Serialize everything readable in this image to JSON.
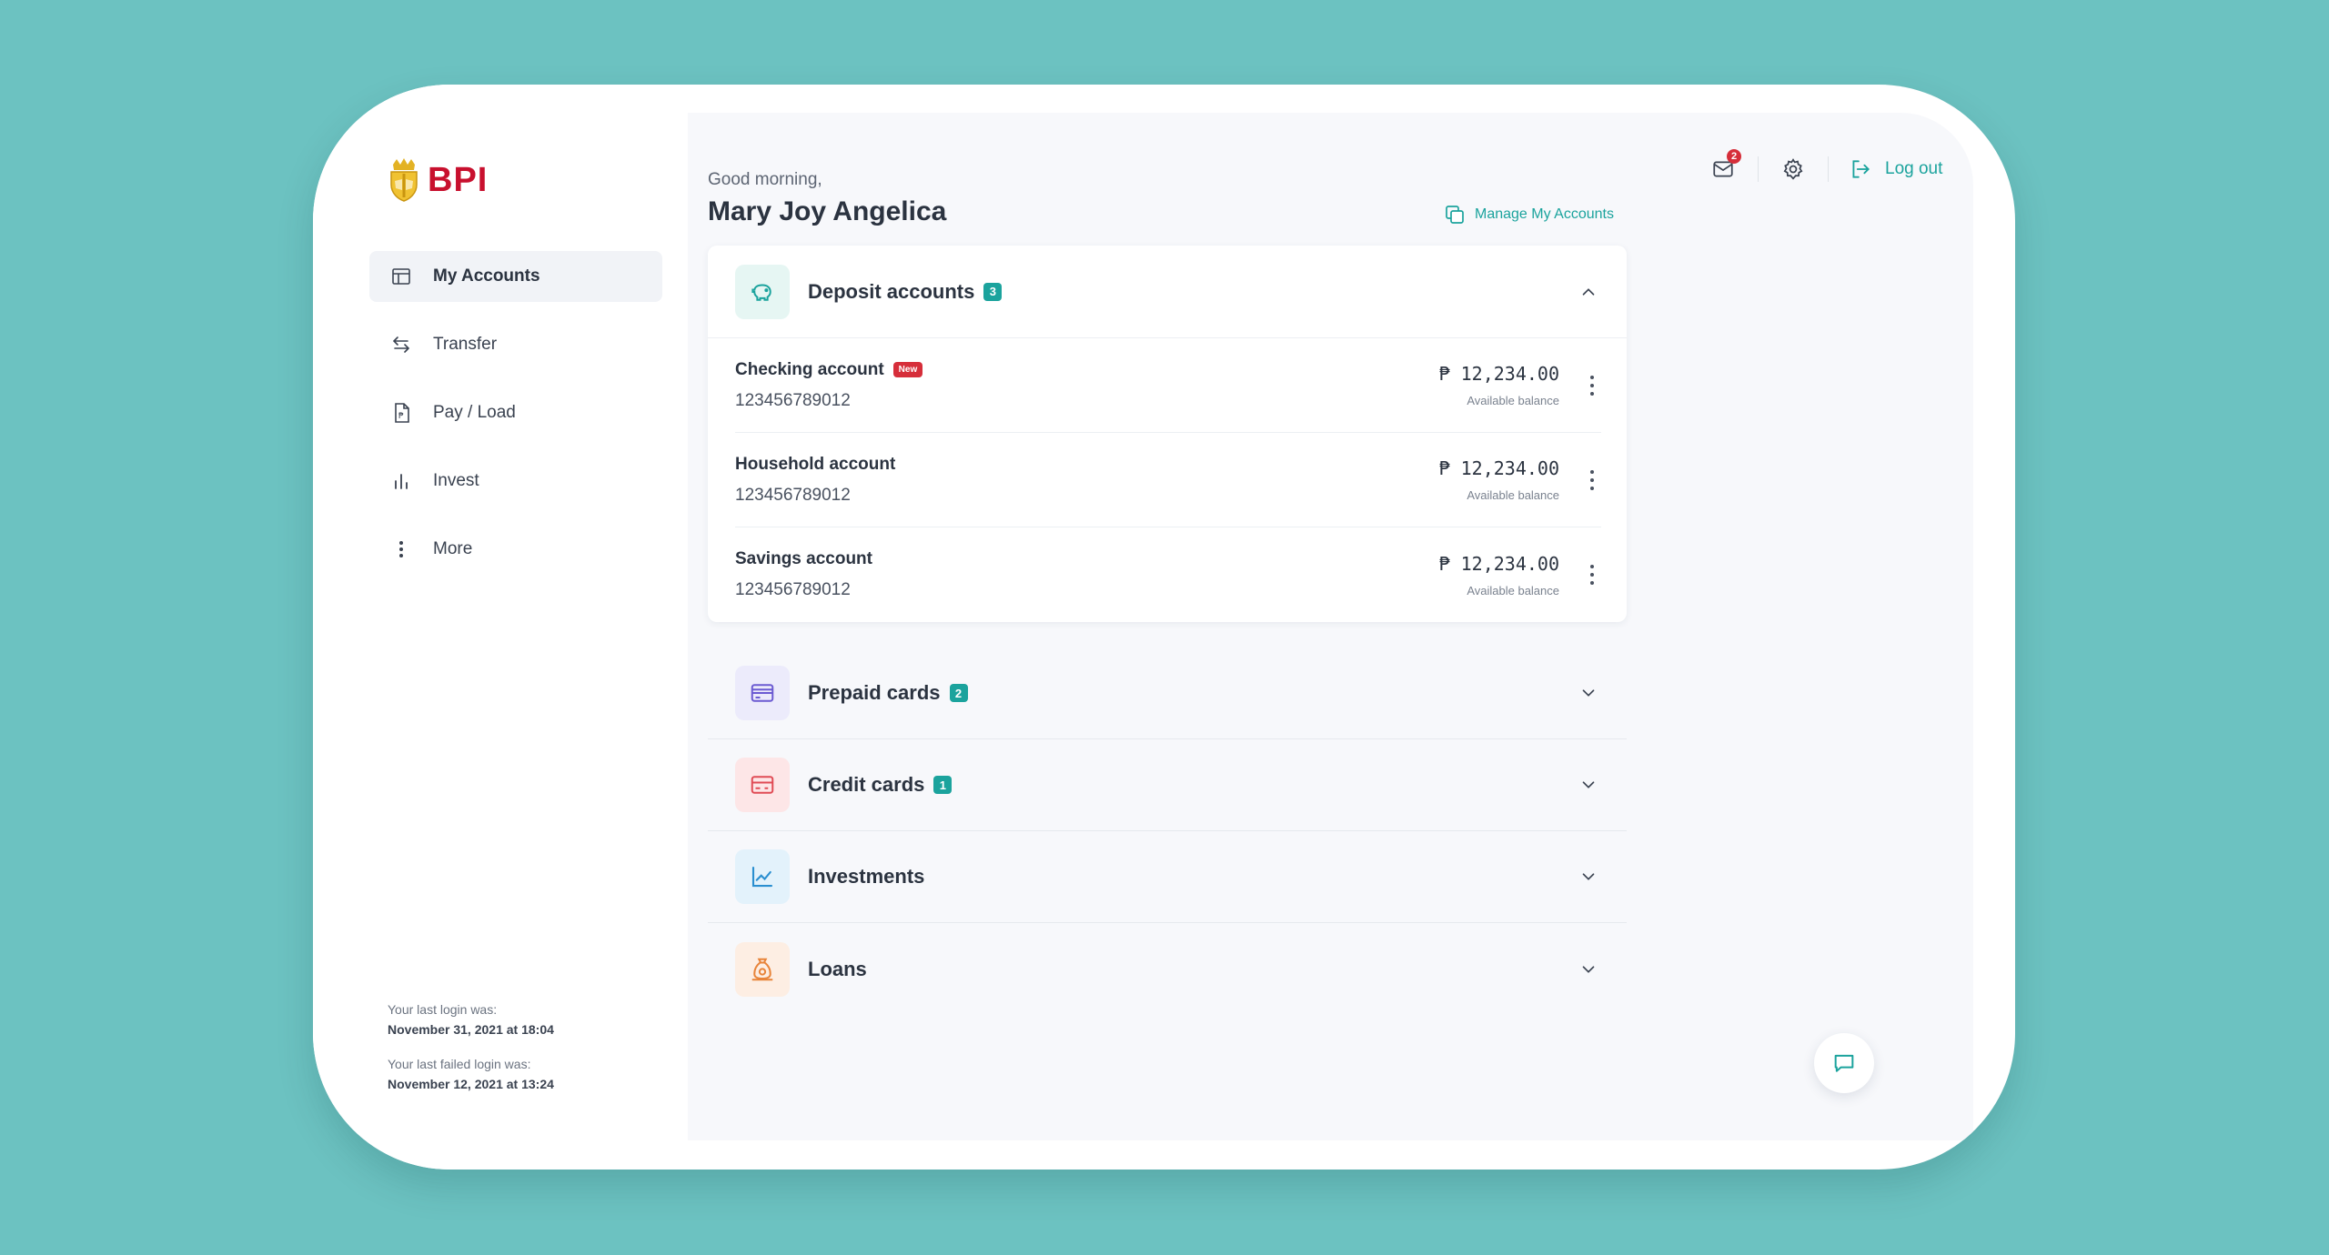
{
  "brand": {
    "name": "BPI",
    "logo_icon": "bpi-crest-icon"
  },
  "sidebar": {
    "items": [
      {
        "label": "My Accounts",
        "icon": "table-icon",
        "active": true
      },
      {
        "label": "Transfer",
        "icon": "transfer-arrows-icon",
        "active": false
      },
      {
        "label": "Pay / Load",
        "icon": "bill-icon",
        "active": false
      },
      {
        "label": "Invest",
        "icon": "bar-chart-icon",
        "active": false
      },
      {
        "label": "More",
        "icon": "vertical-dots-icon",
        "active": false
      }
    ],
    "last_login_label": "Your last login was:",
    "last_login_value": "November 31, 2021 at 18:04",
    "last_failed_label": "Your last failed login was:",
    "last_failed_value": "November 12, 2021 at 13:24"
  },
  "header": {
    "greeting": "Good morning,",
    "user_name": "Mary Joy Angelica",
    "manage_label": "Manage My Accounts",
    "mail_badge": "2",
    "logout_label": "Log out"
  },
  "sections": {
    "deposit": {
      "title": "Deposit accounts",
      "count": "3",
      "accounts": [
        {
          "name": "Checking account",
          "tag": "New",
          "number": "123456789012",
          "balance": "₱ 12,234.00",
          "balance_label": "Available balance"
        },
        {
          "name": "Household account",
          "tag": "",
          "number": "123456789012",
          "balance": "₱ 12,234.00",
          "balance_label": "Available balance"
        },
        {
          "name": "Savings account",
          "tag": "",
          "number": "123456789012",
          "balance": "₱ 12,234.00",
          "balance_label": "Available balance"
        }
      ]
    },
    "prepaid": {
      "title": "Prepaid cards",
      "count": "2"
    },
    "credit": {
      "title": "Credit cards",
      "count": "1"
    },
    "investments": {
      "title": "Investments"
    },
    "loans": {
      "title": "Loans"
    }
  },
  "colors": {
    "background": "#6cc2c1",
    "accent": "#1ba39d",
    "brand_red": "#c8102e",
    "badge_red": "#d62e3a"
  }
}
